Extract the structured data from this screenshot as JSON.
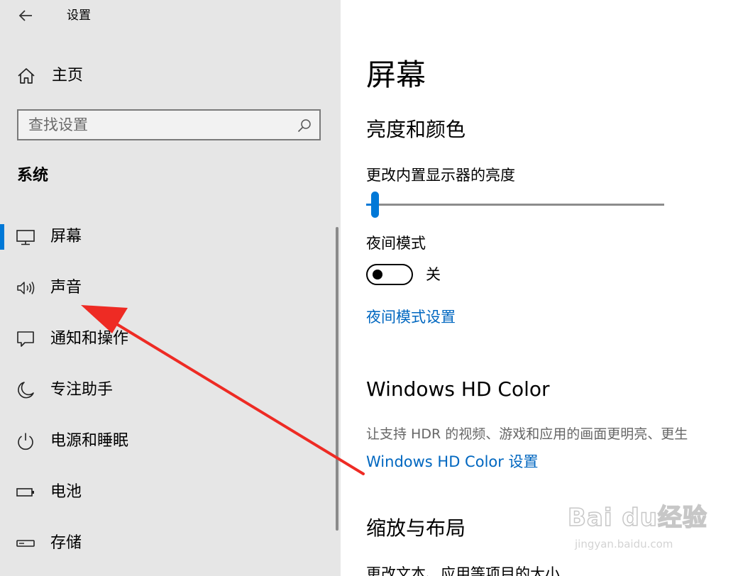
{
  "window": {
    "title": "设置",
    "back_icon": "arrow-left-icon"
  },
  "sidebar": {
    "home": {
      "label": "主页",
      "icon": "home-icon"
    },
    "search": {
      "placeholder": "查找设置",
      "value": "",
      "icon": "search-icon"
    },
    "group_title": "系统",
    "items": [
      {
        "label": "屏幕",
        "icon": "monitor-icon",
        "selected": true
      },
      {
        "label": "声音",
        "icon": "speaker-icon",
        "selected": false
      },
      {
        "label": "通知和操作",
        "icon": "notification-icon",
        "selected": false
      },
      {
        "label": "专注助手",
        "icon": "moon-icon",
        "selected": false
      },
      {
        "label": "电源和睡眠",
        "icon": "power-icon",
        "selected": false
      },
      {
        "label": "电池",
        "icon": "battery-icon",
        "selected": false
      },
      {
        "label": "存储",
        "icon": "storage-icon",
        "selected": false
      }
    ]
  },
  "main": {
    "page_title": "屏幕",
    "brightness": {
      "section_title": "亮度和颜色",
      "label": "更改内置显示器的亮度",
      "value_percent": 2
    },
    "night_light": {
      "label": "夜间模式",
      "state_label": "关",
      "on": false,
      "settings_link": "夜间模式设置"
    },
    "hd_color": {
      "section_title": "Windows HD Color",
      "description": "让支持 HDR 的视频、游戏和应用的画面更明亮、更生",
      "settings_link": "Windows HD Color 设置"
    },
    "scale_layout": {
      "section_title": "缩放与布局",
      "label": "更改文本、应用等项目的大小"
    }
  },
  "annotation": {
    "color": "#ee2b24"
  },
  "watermark": {
    "brand": "Bai du经验",
    "url": "jingyan.baidu.com"
  },
  "colors": {
    "accent": "#0078d7",
    "link": "#0067c0",
    "sidebar_bg": "#e6e6e6"
  }
}
